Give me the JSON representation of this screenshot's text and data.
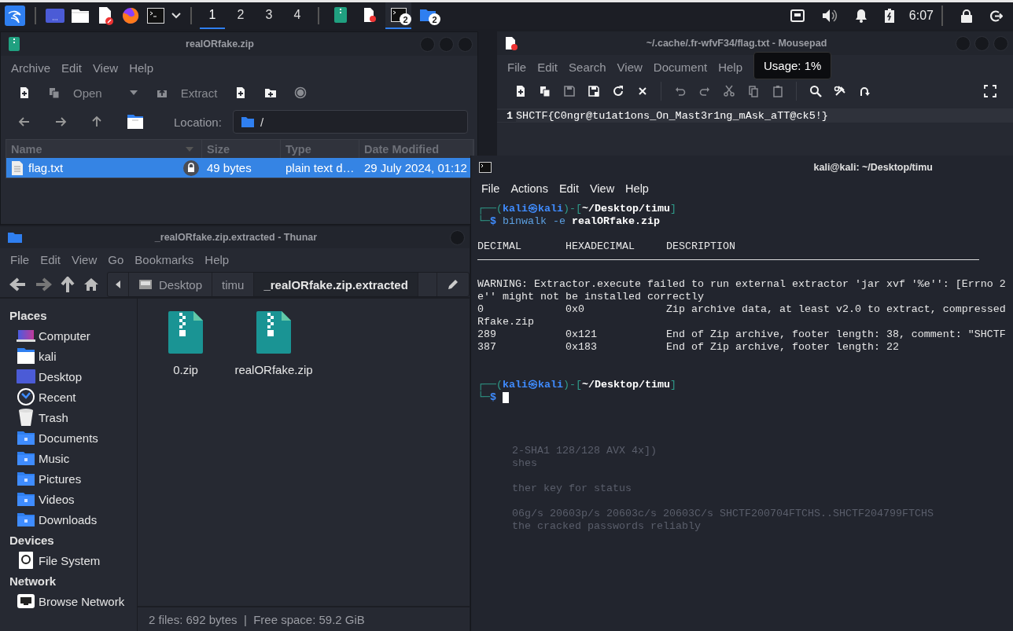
{
  "panel": {
    "launchers": [
      {
        "kind": "desktop"
      },
      {
        "kind": "files"
      },
      {
        "kind": "editor"
      },
      {
        "kind": "browser"
      },
      {
        "kind": "terminal"
      },
      {
        "kind": "caret"
      }
    ],
    "workspaces": [
      {
        "label": "1",
        "selected": true
      },
      {
        "label": "2",
        "selected": false
      },
      {
        "label": "3",
        "selected": false
      },
      {
        "label": "4",
        "selected": false
      }
    ],
    "tasks": [
      {
        "kind": "archive",
        "selected": false
      },
      {
        "kind": "editor",
        "selected": false
      },
      {
        "kind": "terminal",
        "badge": "2",
        "selected": true
      },
      {
        "kind": "folder",
        "badge": "2",
        "selected": false
      }
    ],
    "tray": [
      {
        "kind": "network"
      },
      {
        "kind": "volume"
      },
      {
        "kind": "bell"
      },
      {
        "kind": "battery"
      }
    ],
    "clock": "6:07"
  },
  "archiver": {
    "title": "realORfake.zip",
    "menu": [
      "Archive",
      "Edit",
      "View",
      "Help"
    ],
    "toolbar": [
      {
        "kind": "new",
        "disabled": false
      },
      {
        "kind": "open",
        "label": "Open",
        "disabled": true
      },
      {
        "kind": "extract",
        "label": "Extract",
        "disabled": true
      },
      {
        "kind": "add-file",
        "disabled": false
      },
      {
        "kind": "add-folder",
        "disabled": false
      },
      {
        "kind": "stop",
        "disabled": true
      }
    ],
    "location_label": "Location:",
    "location": "/",
    "columns": [
      "Name",
      "Size",
      "Type",
      "Date Modified"
    ],
    "rows": [
      {
        "name": "flag.txt",
        "size": "49 bytes",
        "type": "plain text d…",
        "date": "29 July 2024, 01:12",
        "locked": true,
        "selected": true
      }
    ]
  },
  "mousepad": {
    "title": "~/.cache/.fr-wfvF34/flag.txt - Mousepad",
    "menu": [
      "File",
      "Edit",
      "Search",
      "View",
      "Document",
      "Help"
    ],
    "toolbar": [
      {
        "kind": "new",
        "disabled": false
      },
      {
        "kind": "open",
        "disabled": false
      },
      {
        "kind": "save",
        "disabled": true
      },
      {
        "kind": "save-as",
        "disabled": false
      },
      {
        "kind": "reload",
        "disabled": false
      },
      {
        "kind": "close",
        "disabled": false
      },
      {
        "kind": "sep"
      },
      {
        "kind": "undo",
        "disabled": true
      },
      {
        "kind": "redo",
        "disabled": true
      },
      {
        "kind": "cut",
        "disabled": true
      },
      {
        "kind": "copy",
        "disabled": true
      },
      {
        "kind": "paste",
        "disabled": true
      },
      {
        "kind": "sep"
      },
      {
        "kind": "search",
        "disabled": false
      },
      {
        "kind": "replace",
        "disabled": false
      },
      {
        "kind": "goto",
        "disabled": false
      },
      {
        "kind": "spacer"
      },
      {
        "kind": "fullscreen",
        "disabled": false
      }
    ],
    "lines": [
      {
        "number": "1",
        "text": "SHCTF{C0ngr@tu1at1ons_On_Mast3r1ng_mAsk_aTT@ck5!}"
      }
    ]
  },
  "tooltip": "Usage: 1%",
  "terminal": {
    "title": "kali@kali: ~/Desktop/timu",
    "menu": [
      "File",
      "Actions",
      "Edit",
      "View",
      "Help"
    ],
    "lines": [
      {
        "kind": "prompt",
        "segments": [
          {
            "text": "┌──(",
            "kind": "frame"
          },
          {
            "text": "kali㉿kali",
            "kind": "user"
          },
          {
            "text": ")-[",
            "kind": "frame"
          },
          {
            "text": "~/Desktop/timu",
            "kind": "path"
          },
          {
            "text": "]",
            "kind": "frame"
          }
        ]
      },
      {
        "kind": "prompt",
        "segments": [
          {
            "text": "└─",
            "kind": "frame"
          },
          {
            "text": "$",
            "kind": "user"
          },
          {
            "text": " binwalk -e ",
            "kind": "command"
          },
          {
            "text": "realORfake.zip",
            "kind": "path"
          }
        ]
      },
      {
        "kind": "blank"
      },
      {
        "kind": "output",
        "text": "DECIMAL       HEXADECIMAL     DESCRIPTION"
      },
      {
        "kind": "rule"
      },
      {
        "kind": "blank"
      },
      {
        "kind": "output",
        "text": "WARNING: Extractor.execute failed to run external extractor 'jar xvf '%e'': [Errno 2"
      },
      {
        "kind": "output",
        "text": "e'' might not be installed correctly"
      },
      {
        "kind": "output",
        "text": "0             0x0             Zip archive data, at least v2.0 to extract, compressed"
      },
      {
        "kind": "output",
        "text": "Rfake.zip"
      },
      {
        "kind": "output",
        "text": "289           0x121           End of Zip archive, footer length: 38, comment: \"SHCTF"
      },
      {
        "kind": "output",
        "text": "387           0x183           End of Zip archive, footer length: 22"
      },
      {
        "kind": "blank"
      },
      {
        "kind": "blank"
      },
      {
        "kind": "prompt",
        "segments": [
          {
            "text": "┌──(",
            "kind": "frame"
          },
          {
            "text": "kali㉿kali",
            "kind": "user"
          },
          {
            "text": ")-[",
            "kind": "frame"
          },
          {
            "text": "~/Desktop/timu",
            "kind": "path"
          },
          {
            "text": "]",
            "kind": "frame"
          }
        ]
      },
      {
        "kind": "input",
        "segments": [
          {
            "text": "└─",
            "kind": "frame"
          },
          {
            "text": "$",
            "kind": "user"
          }
        ]
      }
    ],
    "ghost_blocks": [
      [
        "2-SHA1 128/128 AVX 4x])",
        "shes"
      ],
      [
        "ther key for status"
      ],
      [
        "06g/s 20603p/s 20603c/s 20603C/s SHCTF200704FTCHS..SHCTF204799FTCHS",
        "the cracked passwords reliably"
      ]
    ]
  },
  "thunar": {
    "title": "_realORfake.zip.extracted - Thunar",
    "menu": [
      "File",
      "Edit",
      "View",
      "Go",
      "Bookmarks",
      "Help"
    ],
    "path": [
      {
        "label": "Desktop",
        "kind": "drive",
        "selected": false
      },
      {
        "label": "timu",
        "kind": "plain",
        "selected": false
      },
      {
        "label": "_realORfake.zip.extracted",
        "kind": "plain",
        "selected": true
      }
    ],
    "sidebar": [
      {
        "heading": "Places",
        "items": [
          {
            "label": "Computer",
            "kind": "computer"
          },
          {
            "label": "kali",
            "kind": "home"
          },
          {
            "label": "Desktop",
            "kind": "desktop"
          },
          {
            "label": "Recent",
            "kind": "recent"
          },
          {
            "label": "Trash",
            "kind": "trash"
          },
          {
            "label": "Documents",
            "kind": "folder"
          },
          {
            "label": "Music",
            "kind": "folder"
          },
          {
            "label": "Pictures",
            "kind": "folder"
          },
          {
            "label": "Videos",
            "kind": "folder"
          },
          {
            "label": "Downloads",
            "kind": "folder"
          }
        ]
      },
      {
        "heading": "Devices",
        "items": [
          {
            "label": "File System",
            "kind": "drive"
          }
        ]
      },
      {
        "heading": "Network",
        "items": [
          {
            "label": "Browse Network",
            "kind": "network"
          }
        ]
      }
    ],
    "files": [
      {
        "name": "0.zip"
      },
      {
        "name": "realORfake.zip"
      }
    ],
    "status": "2 files: 692 bytes  |  Free space: 59.2 GiB"
  }
}
